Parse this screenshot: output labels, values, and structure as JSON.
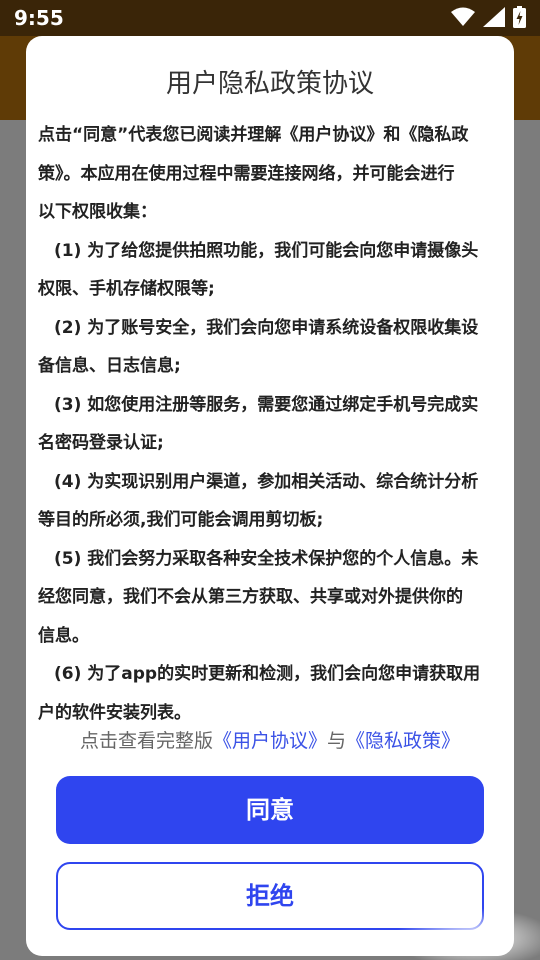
{
  "status_bar": {
    "time": "9:55",
    "icons": [
      "wifi-icon",
      "signal-icon",
      "battery-charging-icon"
    ]
  },
  "dialog": {
    "title": "用户隐私政策协议",
    "intro_lines": [
      "点击“同意”代表您已阅读并理解《用户协议》和《隐私政",
      "策》。本应用在使用过程中需要连接网络，并可能会进行",
      "以下权限收集："
    ],
    "items": [
      "(1) 为了给您提供拍照功能，我们可能会向您申请摄像头",
      "权限、手机存储权限等;",
      "(2) 为了账号安全，我们会向您申请系统设备权限收集设",
      "备信息、日志信息;",
      "(3) 如您使用注册等服务，需要您通过绑定手机号完成实",
      "名密码登录认证;",
      "(4) 为实现识别用户渠道，参加相关活动、综合统计分析",
      "等目的所必须,我们可能会调用剪切板;",
      "(5) 我们会努力采取各种安全技术保护您的个人信息。未",
      "经您同意，我们不会从第三方获取、共享或对外提供你的",
      "信息。",
      "(6) 为了app的实时更新和检测，我们会向您申请获取用",
      "户的软件安装列表。"
    ],
    "footer_prefix": "点击查看完整版",
    "footer_link_user": "《用户协议》",
    "footer_joiner": "与",
    "footer_link_privacy": "《隐私政策》",
    "agree_label": "同意",
    "reject_label": "拒绝"
  },
  "colors": {
    "accent": "#2f45ef",
    "link": "#3b52e6",
    "header": "#5f3b06"
  }
}
